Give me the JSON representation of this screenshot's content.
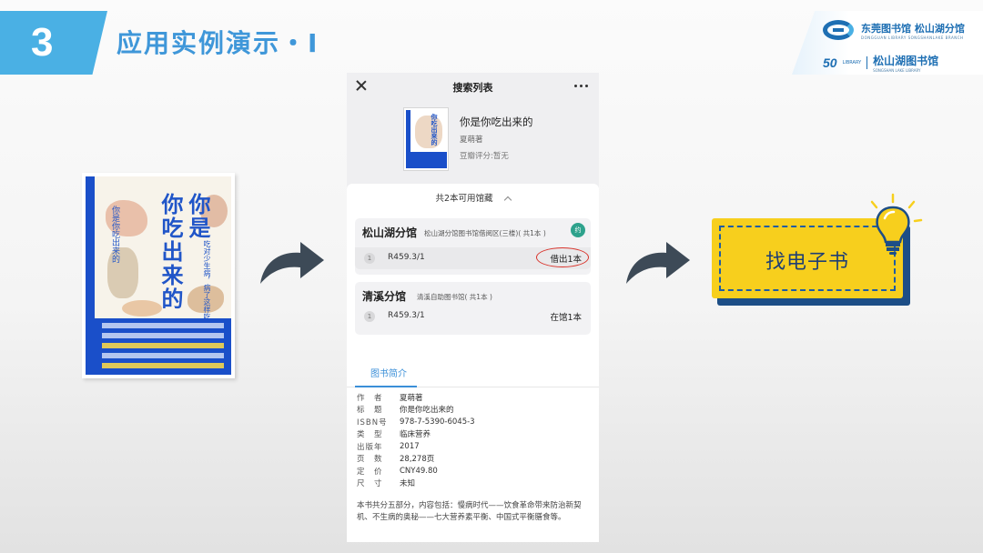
{
  "header": {
    "section_number": "3",
    "title": "应用实例演示・I",
    "logo_name": "东莞图书馆 松山湖分馆",
    "logo_english": "DONGGUAN LIBRARY SONGSHANLAKE BRANCH",
    "logo_50": "50",
    "logo_library": "LIBRARY",
    "logo_subname": "松山湖图书馆",
    "logo_sub_english": "SONGSHAN LAKE LIBRARY"
  },
  "book_cover": {
    "title_line1": "你吃出来的",
    "title_line2": "你是",
    "subtitle": "吃对少生病，病了这样吃",
    "spine_text": "你是你吃出来的"
  },
  "phone": {
    "nav_title": "搜索列表",
    "book": {
      "name": "你是你吃出来的",
      "author": "夏萌著",
      "rating": "豆瓣评分:暂无"
    },
    "availability_header": "共2本可用馆藏",
    "branches": [
      {
        "name": "松山湖分馆",
        "location": "松山湖分馆图书馆借阅区(三楼)( 共1本 )",
        "badge": "约",
        "index": "1",
        "call_number": "R459.3/1",
        "status": "借出1本"
      },
      {
        "name": "清溪分馆",
        "location": "清溪自助图书馆( 共1本 )",
        "index": "1",
        "call_number": "R459.3/1",
        "status": "在馆1本"
      }
    ],
    "tab_label": "图书简介",
    "details": [
      {
        "key": "作　者",
        "value": "夏萌著"
      },
      {
        "key": "标　题",
        "value": "你是你吃出来的"
      },
      {
        "key": "ISBN号",
        "value": "978-7-5390-6045-3"
      },
      {
        "key": "类　型",
        "value": "临床营养"
      },
      {
        "key": "出版年",
        "value": "2017"
      },
      {
        "key": "页　数",
        "value": "28,278页"
      },
      {
        "key": "定　价",
        "value": "CNY49.80"
      },
      {
        "key": "尺　寸",
        "value": "未知"
      }
    ],
    "summary": "本书共分五部分，内容包括：慢病时代——饮食革命带来防治新契机、不生病的奥秘——七大营养素平衡、中国式平衡膳食等。"
  },
  "ebook_button": {
    "label": "找电子书"
  },
  "colors": {
    "header_blue": "#4ab0e4",
    "title_blue": "#3f97d9",
    "button_yellow": "#f7cf1d",
    "button_navy": "#1d4e86",
    "arrow_gray": "#3d4a57",
    "status_red": "#d9322a"
  }
}
